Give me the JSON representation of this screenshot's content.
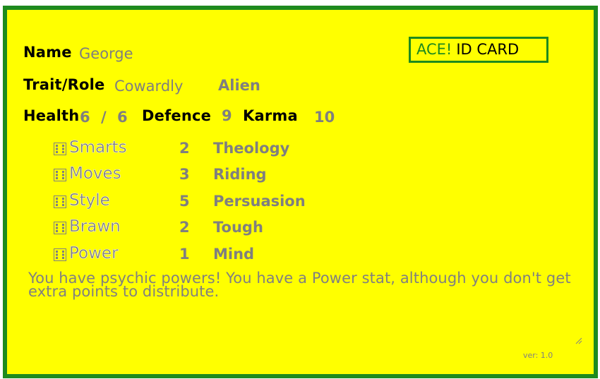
{
  "card": {
    "name_label": "Name",
    "name_value": "George",
    "trait_label": "Trait/Role",
    "trait_value": "Cowardly",
    "role_value": "Alien",
    "health_label": "Health",
    "health_value": "6",
    "health_sep": "/",
    "health_max": "6",
    "defence_label": "Defence",
    "defence_value": "9",
    "karma_label": "Karma",
    "karma_value": "10",
    "id_ace": "ACE!",
    "id_text": "ID CARD",
    "stats": [
      {
        "name": "Smarts",
        "value": "2",
        "skill": "Theology"
      },
      {
        "name": "Moves",
        "value": "3",
        "skill": "Riding"
      },
      {
        "name": "Style",
        "value": "5",
        "skill": "Persuasion"
      },
      {
        "name": "Brawn",
        "value": "2",
        "skill": "Tough"
      },
      {
        "name": "Power",
        "value": "1",
        "skill": "Mind"
      }
    ],
    "description": "You have psychic powers! You have a Power stat, although you don't get extra points to distribute.",
    "version": "ver: 1.0"
  },
  "colors": {
    "background": "#ffff00",
    "border": "#1e8a1e",
    "label": "#000000",
    "value": "#7f7f7f"
  },
  "icons": {
    "dice": "dice-icon",
    "resize": "resize-handle-icon"
  }
}
